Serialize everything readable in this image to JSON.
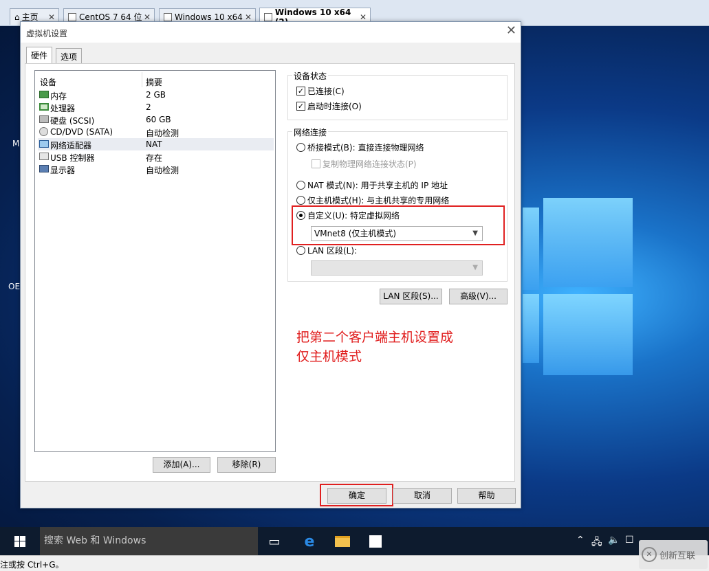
{
  "vm_tabs": [
    {
      "label": "主页",
      "active": false
    },
    {
      "label": "CentOS 7 64 位",
      "active": false
    },
    {
      "label": "Windows 10 x64",
      "active": false
    },
    {
      "label": "Windows 10 x64 (2)",
      "active": true
    }
  ],
  "desktop_fragments": [
    "M",
    "OE"
  ],
  "dialog": {
    "title": "虚拟机设置",
    "tabs": [
      "硬件",
      "选项"
    ],
    "device_list": {
      "headers": [
        "设备",
        "摘要"
      ],
      "rows": [
        {
          "name": "内存",
          "summary": "2 GB",
          "icon": "memory-icon"
        },
        {
          "name": "处理器",
          "summary": "2",
          "icon": "cpu-icon"
        },
        {
          "name": "硬盘 (SCSI)",
          "summary": "60 GB",
          "icon": "harddisk-icon"
        },
        {
          "name": "CD/DVD (SATA)",
          "summary": "自动检测",
          "icon": "cdrom-icon"
        },
        {
          "name": "网络适配器",
          "summary": "NAT",
          "icon": "network-adapter-icon",
          "selected": true
        },
        {
          "name": "USB 控制器",
          "summary": "存在",
          "icon": "usb-icon"
        },
        {
          "name": "显示器",
          "summary": "自动检测",
          "icon": "display-icon"
        }
      ]
    },
    "add_button": "添加(A)...",
    "remove_button": "移除(R)",
    "device_status": {
      "title": "设备状态",
      "connected": "已连接(C)",
      "connect_at_power_on": "启动时连接(O)"
    },
    "network_connection": {
      "title": "网络连接",
      "bridged": "桥接模式(B): 直接连接物理网络",
      "replicate_state": "复制物理网络连接状态(P)",
      "nat": "NAT 模式(N): 用于共享主机的 IP 地址",
      "host_only": "仅主机模式(H): 与主机共享的专用网络",
      "custom": "自定义(U): 特定虚拟网络",
      "custom_value": "VMnet8 (仅主机模式)",
      "lan_segment": "LAN 区段(L):",
      "lan_segment_value": "",
      "selected": "custom"
    },
    "lan_segments_button": "LAN 区段(S)...",
    "advanced_button": "高级(V)...",
    "annotation": [
      "把第二个客户端主机设置成",
      "仅主机模式"
    ],
    "ok_button": "确定",
    "cancel_button": "取消",
    "help_button": "帮助"
  },
  "taskbar": {
    "search_placeholder": "搜索 Web 和 Windows"
  },
  "statusbar": {
    "text": "注或按 Ctrl+G。"
  },
  "watermark": {
    "text": "创新互联"
  },
  "colors": {
    "annotation": "#e01c1c",
    "highlight_box": "#e02020"
  }
}
